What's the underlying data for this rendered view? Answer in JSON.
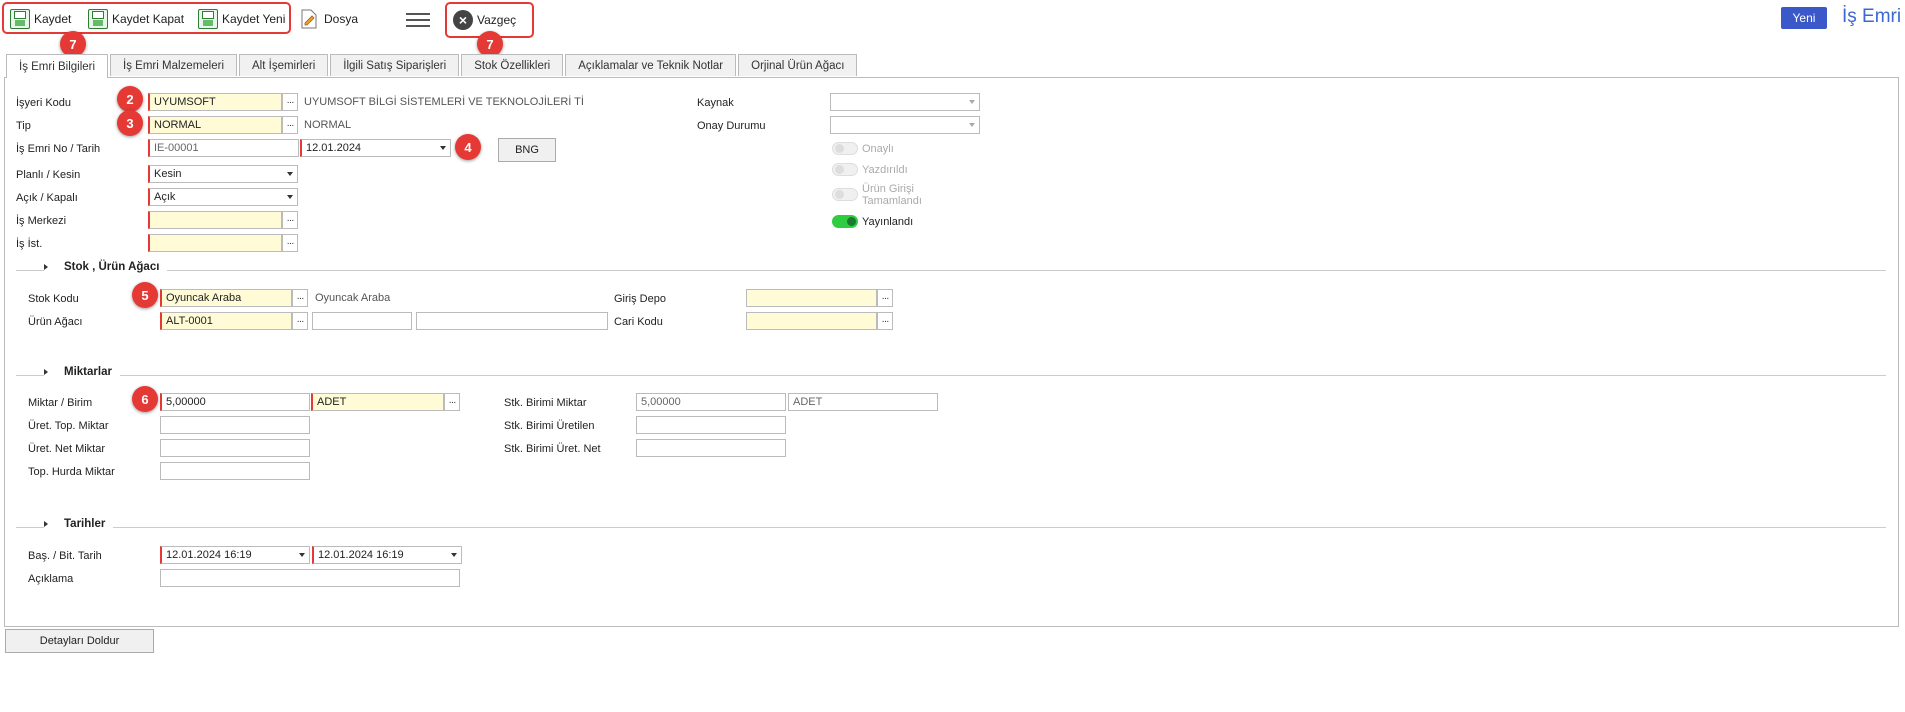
{
  "toolbar": {
    "save_label": "Kaydet",
    "save_close_label": "Kaydet Kapat",
    "save_new_label": "Kaydet Yeni",
    "file_label": "Dosya",
    "cancel_label": "Vazgeç",
    "new_label": "Yeni",
    "page_title": "İş Emri",
    "badge_save": "7",
    "badge_cancel": "7"
  },
  "tabs": [
    {
      "label": "İş Emri Bilgileri"
    },
    {
      "label": "İş Emri Malzemeleri"
    },
    {
      "label": "Alt İşemirleri"
    },
    {
      "label": "İlgili Satış Siparişleri"
    },
    {
      "label": "Stok Özellikleri"
    },
    {
      "label": "Açıklamalar ve Teknik Notlar"
    },
    {
      "label": "Orjinal Ürün Ağacı"
    }
  ],
  "header_form": {
    "workplace_label": "İşyeri Kodu",
    "workplace_value": "UYUMSOFT",
    "workplace_desc": "UYUMSOFT BİLGİ SİSTEMLERİ VE TEKNOLOJİLERİ Tİ",
    "type_label": "Tip",
    "type_value": "NORMAL",
    "type_desc": "NORMAL",
    "order_label": "İş Emri No / Tarih",
    "order_no": "IE-00001",
    "order_date": "12.01.2024",
    "bng_label": "BNG",
    "planned_label": "Planlı / Kesin",
    "planned_value": "Kesin",
    "open_label": "Açık / Kapalı",
    "open_value": "Açık",
    "work_center_label": "İş Merkezi",
    "work_center_value": "",
    "work_station_label": "İş İst.",
    "work_station_value": "",
    "source_label": "Kaynak",
    "source_value": "",
    "approval_label": "Onay Durumu",
    "approval_value": "",
    "badge_workplace": "2",
    "badge_type": "3",
    "badge_date": "4"
  },
  "toggles": {
    "approved": {
      "label": "Onaylı",
      "on": false
    },
    "printed": {
      "label": "Yazdırıldı",
      "on": false
    },
    "product_entry_line1": "Ürün Girişi",
    "product_entry_line2": "Tamamlandı",
    "published": {
      "label": "Yayınlandı",
      "on": true
    }
  },
  "stock_section": {
    "title": "Stok , Ürün Ağacı",
    "stock_code_label": "Stok Kodu",
    "stock_code_value": "Oyuncak Araba",
    "stock_code_desc": "Oyuncak Araba",
    "bom_label": "Ürün Ağacı",
    "bom_value": "ALT-0001",
    "bom_extra1": "",
    "bom_extra2": "",
    "entry_depot_label": "Giriş Depo",
    "entry_depot_value": "",
    "current_code_label": "Cari Kodu",
    "current_code_value": "",
    "badge": "5"
  },
  "quantity_section": {
    "title": "Miktarlar",
    "qty_unit_label": "Miktar / Birim",
    "qty_value": "5,00000",
    "unit_value": "ADET",
    "prod_total_label": "Üret. Top. Miktar",
    "prod_total_value": "",
    "prod_net_label": "Üret. Net Miktar",
    "prod_net_value": "",
    "total_scrap_label": "Top. Hurda Miktar",
    "total_scrap_value": "",
    "stk_unit_qty_label": "Stk. Birimi Miktar",
    "stk_unit_qty_value": "5,00000",
    "stk_unit_value": "ADET",
    "stk_unit_produced_label": "Stk. Birimi Üretilen",
    "stk_unit_produced_value": "",
    "stk_unit_net_label": "Stk. Birimi Üret. Net",
    "stk_unit_net_value": "",
    "badge": "6"
  },
  "dates_section": {
    "title": "Tarihler",
    "start_end_label": "Baş. / Bit. Tarih",
    "start_value": "12.01.2024 16:19",
    "end_value": "12.01.2024 16:19",
    "description_label": "Açıklama",
    "description_value": ""
  },
  "footer": {
    "fill_details_label": "Detayları Doldur"
  }
}
